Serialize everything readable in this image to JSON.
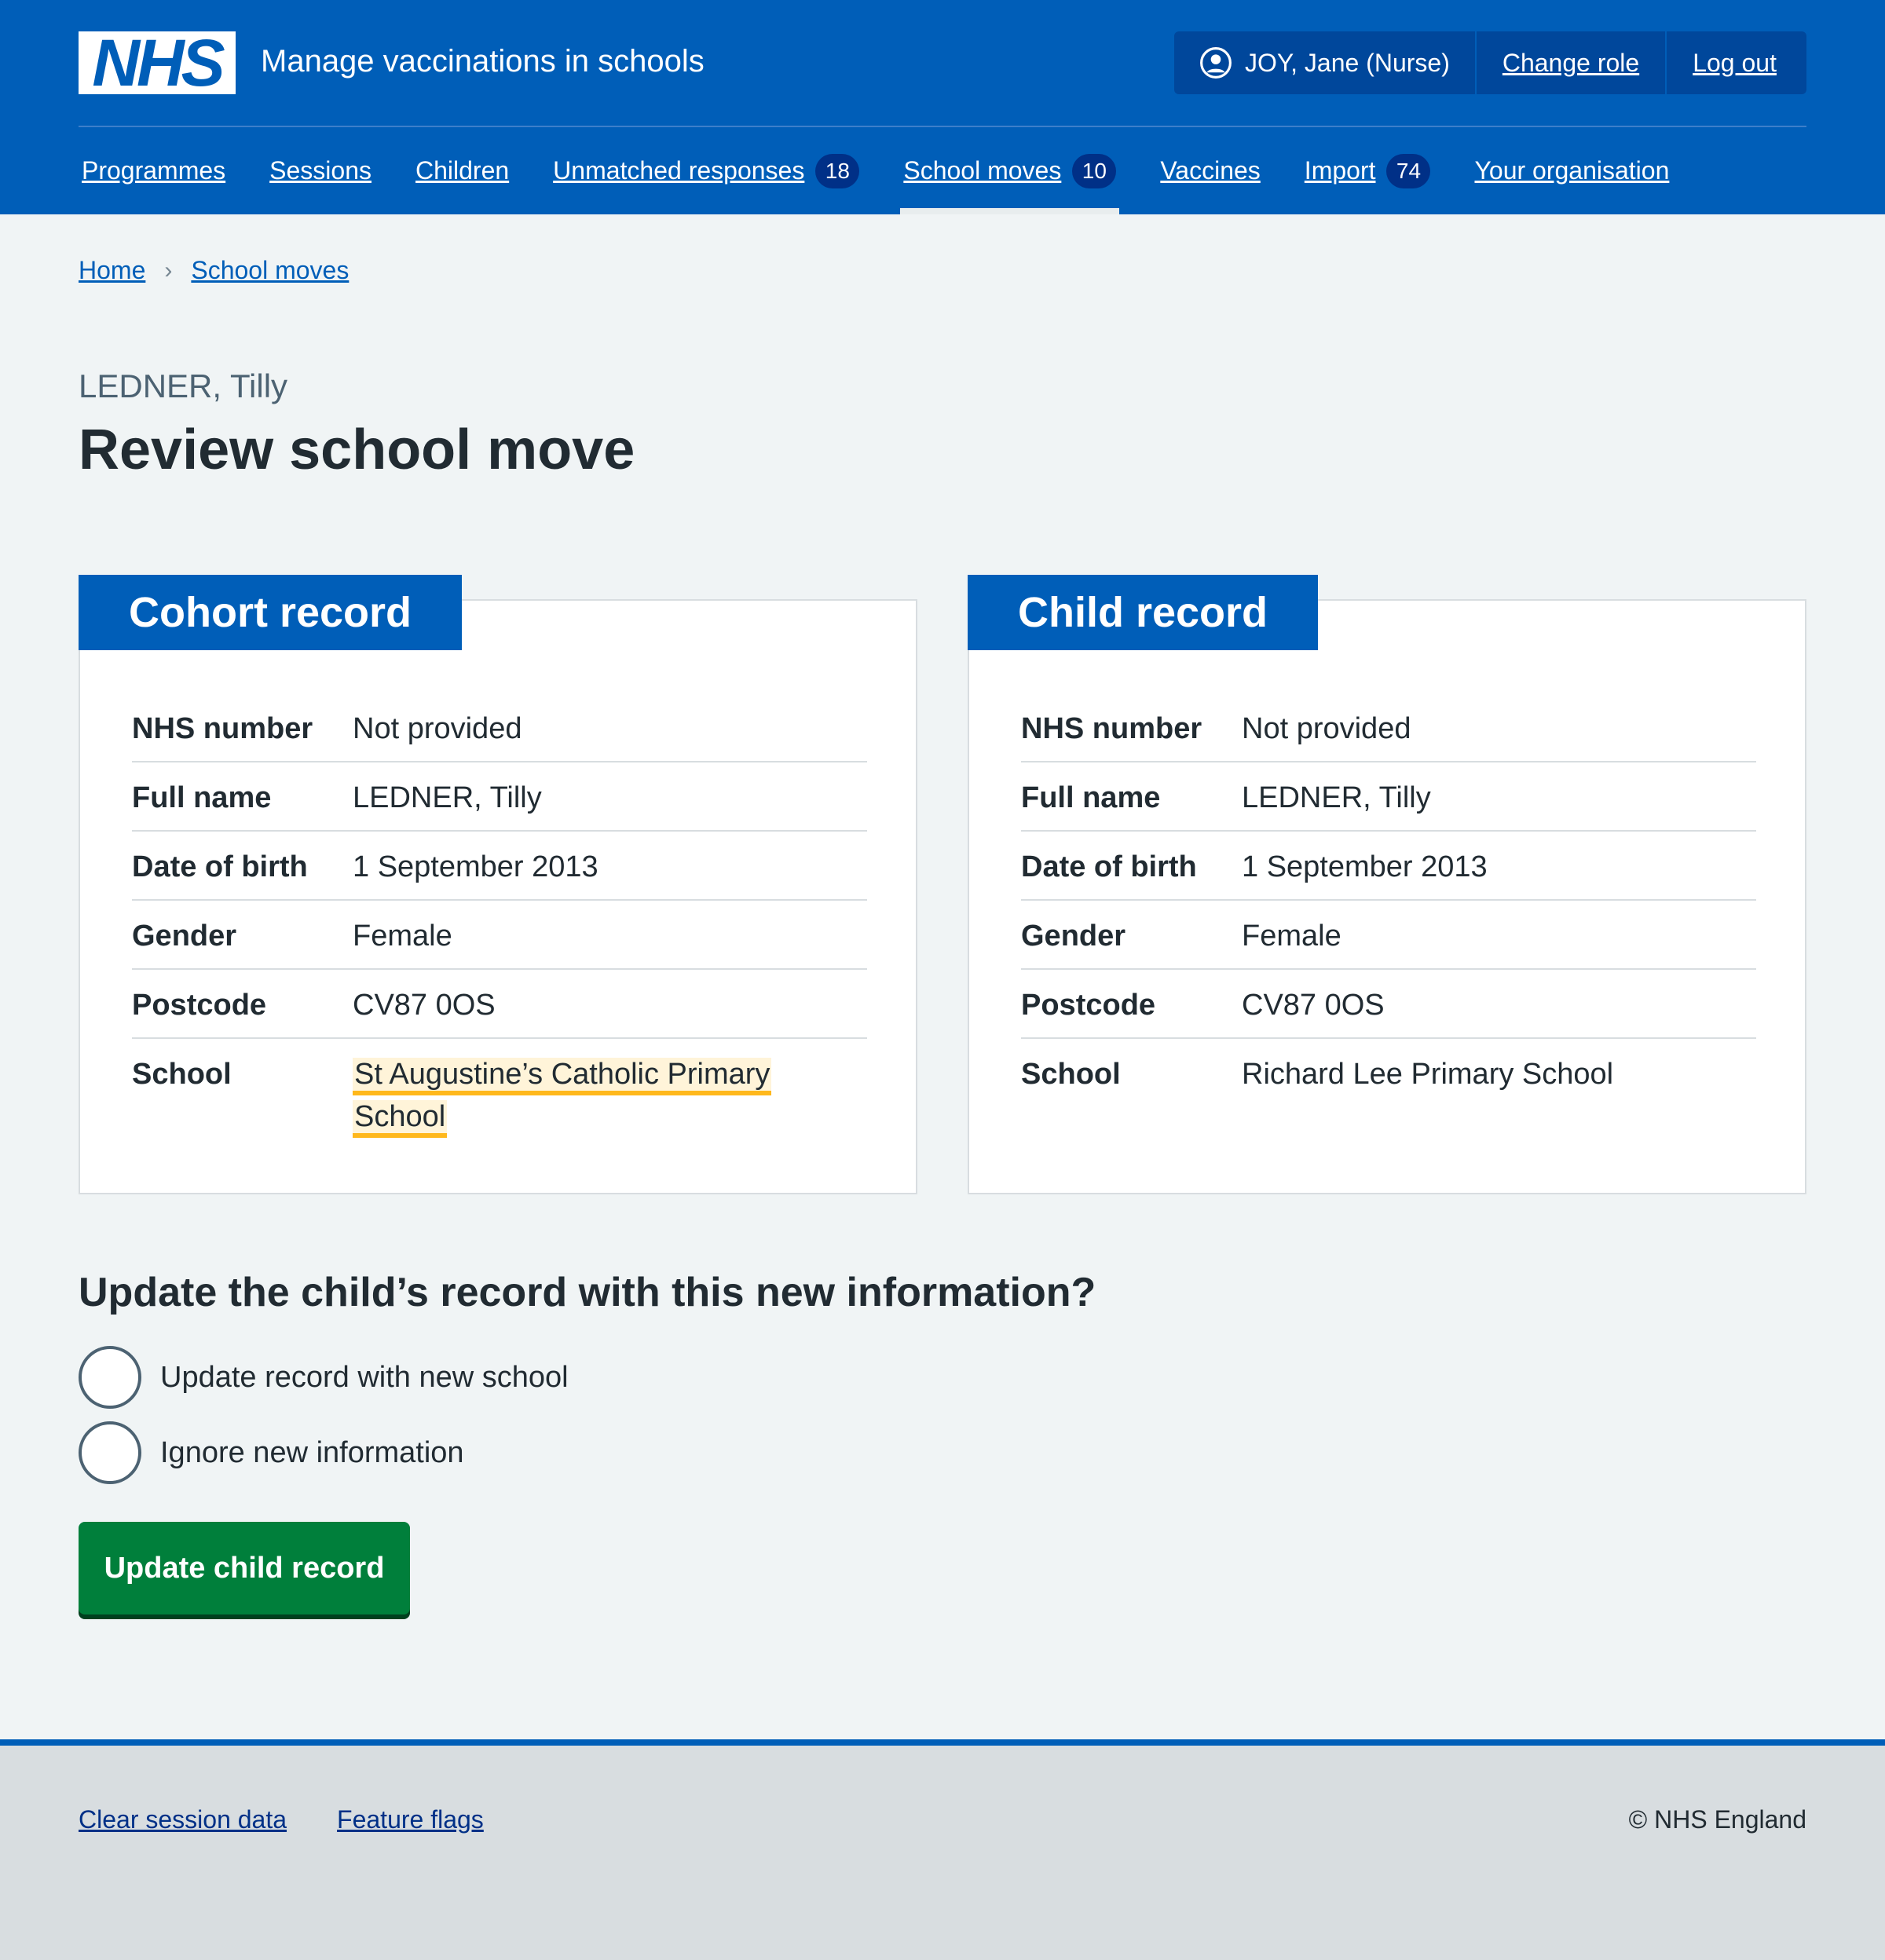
{
  "header": {
    "logo_text": "NHS",
    "service_name": "Manage vaccinations in schools",
    "account": {
      "user": "JOY, Jane (Nurse)",
      "user_icon": "user-circle-icon",
      "change_role": "Change role",
      "log_out": "Log out"
    },
    "nav": [
      {
        "label": "Programmes"
      },
      {
        "label": "Sessions"
      },
      {
        "label": "Children"
      },
      {
        "label": "Unmatched responses",
        "count": "18"
      },
      {
        "label": "School moves",
        "count": "10",
        "active": true
      },
      {
        "label": "Vaccines"
      },
      {
        "label": "Import",
        "count": "74"
      },
      {
        "label": "Your organisation"
      }
    ]
  },
  "breadcrumb": [
    {
      "label": "Home"
    },
    {
      "label": "School moves"
    }
  ],
  "page": {
    "caption": "LEDNER, Tilly",
    "title": "Review school move"
  },
  "cohort_record": {
    "heading": "Cohort record",
    "rows": [
      {
        "key": "NHS number",
        "value": "Not provided"
      },
      {
        "key": "Full name",
        "value": "LEDNER, Tilly"
      },
      {
        "key": "Date of birth",
        "value": "1 September 2013"
      },
      {
        "key": "Gender",
        "value": "Female"
      },
      {
        "key": "Postcode",
        "value": "CV87 0OS"
      },
      {
        "key": "School",
        "value": "St Augustine’s Catholic Primary School",
        "highlighted": true
      }
    ]
  },
  "child_record": {
    "heading": "Child record",
    "rows": [
      {
        "key": "NHS number",
        "value": "Not provided"
      },
      {
        "key": "Full name",
        "value": "LEDNER, Tilly"
      },
      {
        "key": "Date of birth",
        "value": "1 September 2013"
      },
      {
        "key": "Gender",
        "value": "Female"
      },
      {
        "key": "Postcode",
        "value": "CV87 0OS"
      },
      {
        "key": "School",
        "value": "Richard Lee Primary School"
      }
    ]
  },
  "form": {
    "question": "Update the child’s record with this new information?",
    "options": [
      {
        "label": "Update record with new school",
        "selected": false
      },
      {
        "label": "Ignore new information",
        "selected": false
      }
    ],
    "submit": "Update child record"
  },
  "footer": {
    "links": [
      "Clear session data",
      "Feature flags"
    ],
    "copyright": "© NHS England"
  },
  "colors": {
    "nhs_blue": "#005eb8",
    "dark_blue": "#003087",
    "button_green": "#007f3b",
    "highlight_yellow": "#ffb81c",
    "page_background": "#f0f4f5"
  }
}
